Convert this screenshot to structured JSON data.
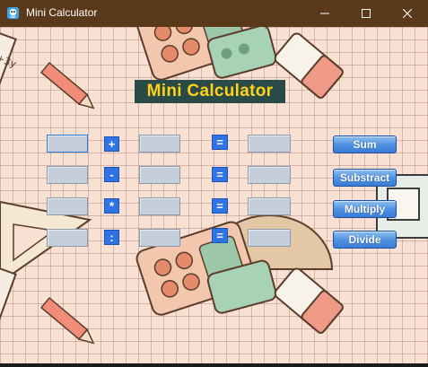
{
  "window": {
    "title": "Mini Calculator",
    "minimize_icon": "minimize-icon",
    "maximize_icon": "maximize-icon",
    "close_icon": "close-icon",
    "titlebar_color": "#5a381a"
  },
  "main": {
    "heading": "Mini Calculator",
    "heading_bg": "#2a4a48",
    "heading_color": "#ffd21a",
    "rows": [
      {
        "operator": "+",
        "equals": "=",
        "a": "",
        "b": "",
        "result": "",
        "button": "Sum"
      },
      {
        "operator": "-",
        "equals": "=",
        "a": "",
        "b": "",
        "result": "",
        "button": "Substract"
      },
      {
        "operator": "*",
        "equals": "=",
        "a": "",
        "b": "",
        "result": "",
        "button": "Multiply"
      },
      {
        "operator": ":",
        "equals": "=",
        "a": "",
        "b": "",
        "result": "",
        "button": "Divide"
      }
    ]
  },
  "colors": {
    "operator_bg": "#2f73e4",
    "field_bg": "#c5cfdc",
    "button_gradient_top": "#8ec0f0",
    "button_gradient_bottom": "#3b7dd4",
    "background": "#f8e0d2"
  }
}
